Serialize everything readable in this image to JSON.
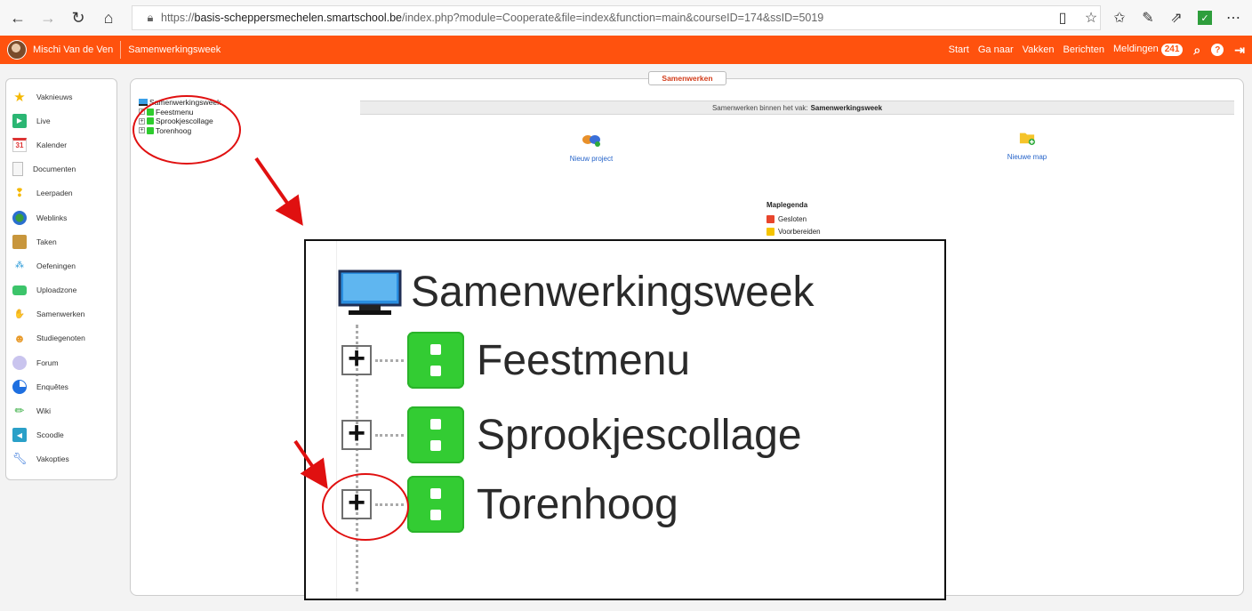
{
  "browser": {
    "url_scheme": "https://",
    "url_host": "basis-scheppersmechelen.smartschool.be",
    "url_path": "/index.php?module=Cooperate&file=index&function=main&courseID=174&ssID=5019"
  },
  "topbar": {
    "user_name": "Mischi Van de Ven",
    "course_name": "Samenwerkingsweek",
    "nav": [
      "Start",
      "Ga naar",
      "Vakken",
      "Berichten"
    ],
    "notifications_label": "Meldingen",
    "notifications_count": "241"
  },
  "sidebar": {
    "items": [
      {
        "label": "Vaknieuws",
        "icon": "star-icon"
      },
      {
        "label": "Live",
        "icon": "video-icon"
      },
      {
        "label": "Kalender",
        "icon": "calendar-icon",
        "icon_text": "31"
      },
      {
        "label": "Documenten",
        "icon": "document-icon"
      },
      {
        "label": "Leerpaden",
        "icon": "footprints-icon"
      },
      {
        "label": "Weblinks",
        "icon": "globe-icon"
      },
      {
        "label": "Taken",
        "icon": "tasks-icon"
      },
      {
        "label": "Oefeningen",
        "icon": "exercises-icon"
      },
      {
        "label": "Uploadzone",
        "icon": "upload-icon"
      },
      {
        "label": "Samenwerken",
        "icon": "handshake-icon"
      },
      {
        "label": "Studiegenoten",
        "icon": "people-icon"
      },
      {
        "label": "Forum",
        "icon": "forum-icon"
      },
      {
        "label": "Enquêtes",
        "icon": "pie-icon"
      },
      {
        "label": "Wiki",
        "icon": "pencil-icon"
      },
      {
        "label": "Scoodle",
        "icon": "scoodle-icon"
      },
      {
        "label": "Vakopties",
        "icon": "wrench-icon"
      }
    ]
  },
  "main": {
    "tab_title": "Samenwerken",
    "tree": {
      "root": "Samenwerkingsweek",
      "children": [
        "Feestmenu",
        "Sprookjescollage",
        "Torenhoog"
      ]
    },
    "header_prefix": "Samenwerken binnen het vak:",
    "header_course": "Samenwerkingsweek",
    "new_project_label": "Nieuw project",
    "new_folder_label": "Nieuwe map",
    "legend": {
      "title": "Maplegenda",
      "items": [
        {
          "label": "Gesloten",
          "color": "#e8452c"
        },
        {
          "label": "Voorbereiden",
          "color": "#f5c400"
        }
      ]
    }
  },
  "zoom": {
    "root": "Samenwerkingsweek",
    "children": [
      "Feestmenu",
      "Sprookjescollage",
      "Torenhoog"
    ]
  },
  "colors": {
    "topbar": "#ff520e",
    "annotation": "#e01010",
    "project_green": "#33cc33"
  }
}
